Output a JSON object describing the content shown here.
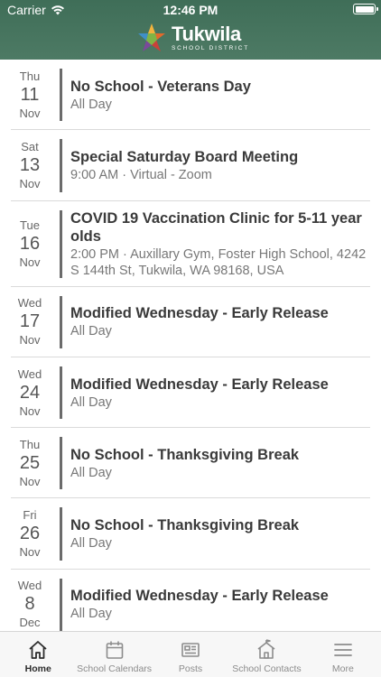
{
  "status": {
    "carrier": "Carrier",
    "time": "12:46 PM"
  },
  "brand": {
    "name": "Tukwila",
    "subtitle": "SCHOOL DISTRICT"
  },
  "events": [
    {
      "dow": "Thu",
      "day": "11",
      "month": "Nov",
      "title": "No School - Veterans Day",
      "detail": "All Day"
    },
    {
      "dow": "Sat",
      "day": "13",
      "month": "Nov",
      "title": "Special Saturday Board Meeting",
      "detail": "9:00 AM · Virtual - Zoom"
    },
    {
      "dow": "Tue",
      "day": "16",
      "month": "Nov",
      "title": "COVID 19 Vaccination Clinic for 5-11 year olds",
      "detail": "2:00 PM · Auxillary Gym, Foster High School, 4242 S 144th St, Tukwila, WA 98168, USA"
    },
    {
      "dow": "Wed",
      "day": "17",
      "month": "Nov",
      "title": "Modified Wednesday - Early Release",
      "detail": "All Day"
    },
    {
      "dow": "Wed",
      "day": "24",
      "month": "Nov",
      "title": "Modified Wednesday - Early Release",
      "detail": "All Day"
    },
    {
      "dow": "Thu",
      "day": "25",
      "month": "Nov",
      "title": "No School - Thanksgiving Break",
      "detail": "All Day"
    },
    {
      "dow": "Fri",
      "day": "26",
      "month": "Nov",
      "title": "No School - Thanksgiving Break",
      "detail": "All Day"
    },
    {
      "dow": "Wed",
      "day": "8",
      "month": "Dec",
      "title": "Modified Wednesday - Early Release",
      "detail": "All Day"
    }
  ],
  "tabs": [
    {
      "label": "Home",
      "icon": "home-icon"
    },
    {
      "label": "School Calendars",
      "icon": "calendar-icon"
    },
    {
      "label": "Posts",
      "icon": "newspaper-icon"
    },
    {
      "label": "School Contacts",
      "icon": "school-icon"
    },
    {
      "label": "More",
      "icon": "menu-icon"
    }
  ],
  "colors": {
    "header": "#4a775f",
    "accent_bar": "#6b6b6b"
  }
}
